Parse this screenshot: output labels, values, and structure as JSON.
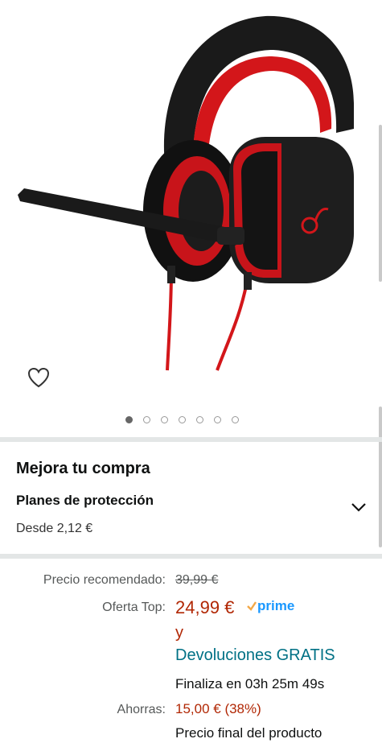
{
  "gallery": {
    "dot_count": 7,
    "active_index": 0
  },
  "upsell": {
    "title": "Mejora tu compra",
    "plan_title": "Planes de protección",
    "plan_price": "Desde 2,12 €"
  },
  "pricing": {
    "list_label": "Precio recomendado:",
    "list_price": "39,99 €",
    "deal_label": "Oferta Top:",
    "deal_price": "24,99 €",
    "prime_label": "prime",
    "and_text": "y",
    "returns_text": "Devoluciones GRATIS",
    "ends_text": "Finaliza en 03h 25m 49s",
    "savings_label": "Ahorras:",
    "savings_value": "15,00 € (38%)",
    "final_text": "Precio final del producto"
  },
  "colors": {
    "price": "#b12704",
    "link": "#007185",
    "prime": "#1a98ff"
  },
  "icons": [
    "heart-icon",
    "chevron-down-icon",
    "prime-check-icon"
  ]
}
